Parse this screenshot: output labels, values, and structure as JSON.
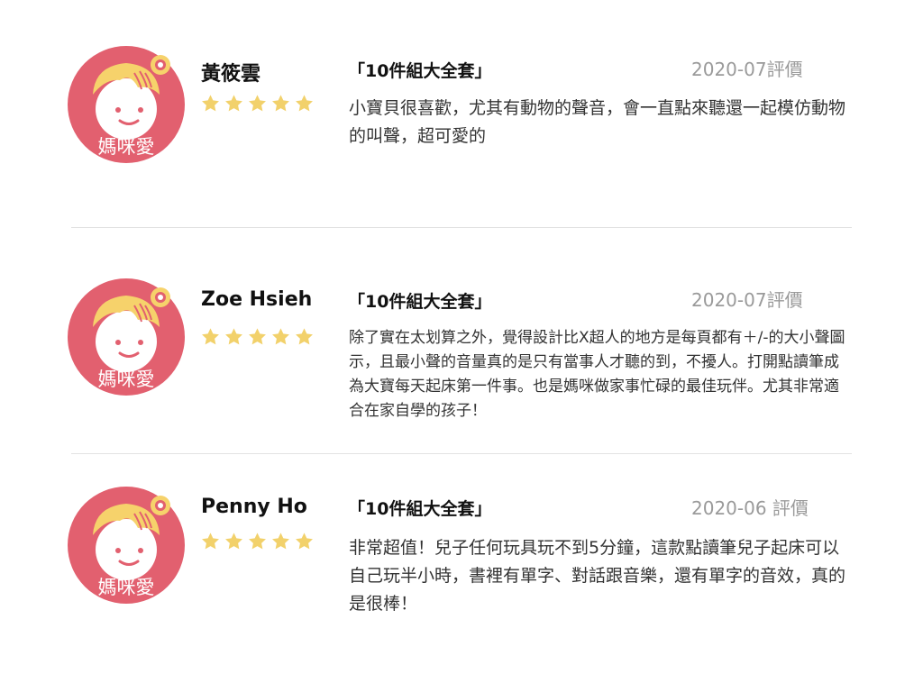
{
  "avatar": {
    "brand_text": "媽咪愛",
    "icon": "baby-face-with-hat-and-bulb",
    "colors": {
      "background": "#E2606F",
      "hat": "#F6D26B",
      "face": "#FFFFFF"
    }
  },
  "rating_star_color": "#F2D16B",
  "reviews": [
    {
      "name": "黃筱雲",
      "stars": 5,
      "product": "「10件組大全套」",
      "date": "2020-07評價",
      "comment": "小寶貝很喜歡，尤其有動物的聲音，會一直點來聽還一起模仿動物的叫聲，超可愛的"
    },
    {
      "name": "Zoe Hsieh",
      "stars": 5,
      "product": "「10件組大全套」",
      "date": "2020-07評價",
      "comment": "除了實在太划算之外，覺得設計比X超人的地方是每頁都有＋/-的大小聲圖示，且最小聲的音量真的是只有當事人才聽的到，不擾人。打開點讀筆成為大寶每天起床第一件事。也是媽咪做家事忙碌的最佳玩伴。尤其非常適合在家自學的孩子！"
    },
    {
      "name": "Penny Ho",
      "stars": 5,
      "product": "「10件組大全套」",
      "date": "2020-06 評價",
      "comment": "非常超值！兒子任何玩具玩不到5分鐘，這款點讀筆兒子起床可以自己玩半小時，書裡有單字、對話跟音樂，還有單字的音效，真的是很棒！"
    }
  ]
}
